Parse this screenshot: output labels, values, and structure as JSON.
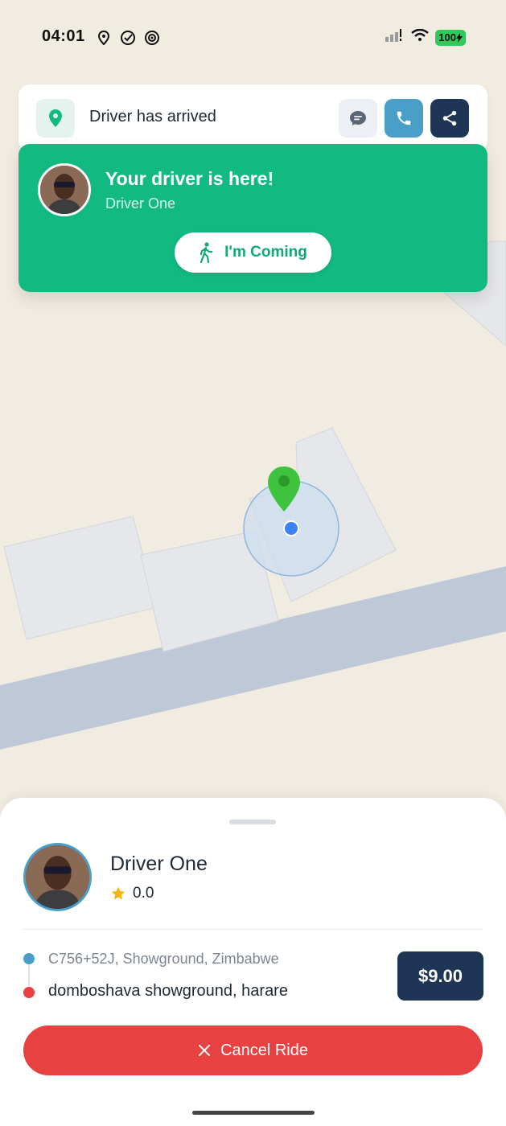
{
  "status_bar": {
    "time": "04:01",
    "battery": "100"
  },
  "top_bar": {
    "title": "Driver has arrived",
    "pin_icon": "location-pin-icon",
    "chat_icon": "chat-icon",
    "call_icon": "phone-icon",
    "share_icon": "share-icon"
  },
  "arrived_card": {
    "title": "Your driver is here!",
    "driver_name": "Driver One",
    "coming_button_label": "I'm Coming",
    "coming_icon": "walking-person-icon"
  },
  "driver": {
    "name": "Driver One",
    "rating": "0.0"
  },
  "route": {
    "pickup": "C756+52J, Showground, Zimbabwe",
    "dropoff": "domboshava showground, harare"
  },
  "fare": "$9.00",
  "cancel_button_label": "Cancel Ride",
  "colors": {
    "accent_green": "#12b981",
    "navy": "#1e3556",
    "blue": "#4a9fc8",
    "red": "#e84141"
  }
}
